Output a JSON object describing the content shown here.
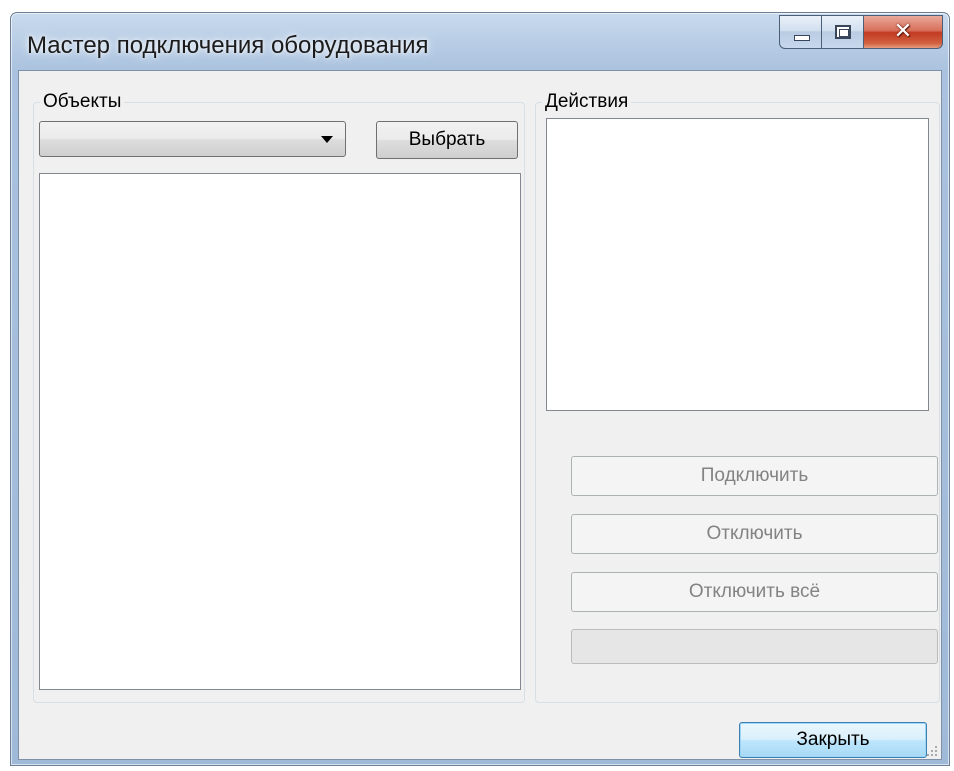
{
  "window": {
    "title": "Мастер подключения оборудования"
  },
  "objects_group": {
    "legend": "Объекты",
    "combo_value": "",
    "select_button": "Выбрать",
    "list_items": []
  },
  "actions_group": {
    "legend": "Действия",
    "list_items": [],
    "connect_button": "Подключить",
    "disconnect_button": "Отключить",
    "disconnect_all_button": "Отключить всё",
    "progress": 0
  },
  "footer": {
    "close_button": "Закрыть"
  },
  "icons": {
    "minimize": "minimize-icon",
    "maximize": "maximize-icon",
    "close": "close-icon",
    "dropdown": "chevron-down-icon",
    "size_grip": "size-grip-icon"
  }
}
